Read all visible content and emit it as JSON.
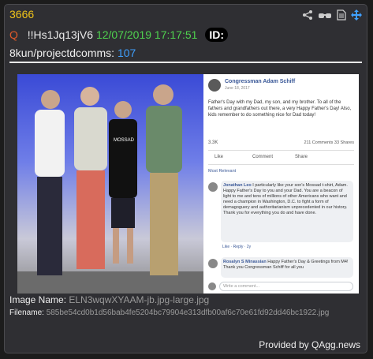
{
  "post": {
    "number": "3666",
    "q_marker": "Q",
    "tripcode": "!!Hs1Jq13jV6",
    "date": "12/07/2019 17:17:51",
    "id_label": "ID:",
    "board": "8kun/projectdcomms:",
    "ref_num": "107"
  },
  "image": {
    "name_label": "Image Name:",
    "name": "ELN3wqwXYAAM-jb.jpg-large.jpg",
    "file_label": "Filename:",
    "filename": "585be54cd0b1d56bab4fe5204bc79904e313dfb00af6c70e61fd92dd46bc1922.jpg",
    "fb_post": {
      "author": "Congressman Adam Schiff",
      "date": "June 18, 2017",
      "text": "Father's Day with my Dad, my son, and my brother. To all of the fathers and grandfathers out there, a very Happy Father's Day! Also, kids remember to do something nice for Dad today!",
      "reactions": "3.3K",
      "comments": "211 Comments  33 Shares",
      "like": "Like",
      "comment": "Comment",
      "share": "Share",
      "sort": "Most Relevant",
      "c1_author": "Jonathan Leo",
      "c1_text": "I particularly like your son's Mossad t-shirt, Adam. Happy Father's Day to you and your Dad. You are a beacon of light to me and tens of millions of other Americans who want and need a champion in Washington, D.C. to fight a form of demagoguery and authoritarianism unprecedented in our history. Thank you for everything you do and have done.",
      "c1_actions": "Like · Reply · 2y",
      "c2_author": "Rosalyn S Minassian",
      "c2_text": "Happy Father's Day & Greetings from M4! Thank you Congressman Schiff for all you",
      "write": "Write a comment..."
    }
  },
  "footer": {
    "provider": "Provided by QAgg.news"
  }
}
